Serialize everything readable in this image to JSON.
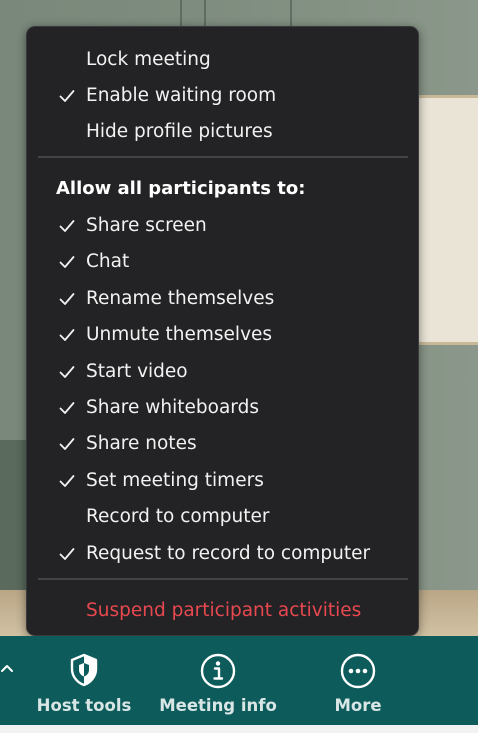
{
  "menu": {
    "top_items": [
      {
        "label": "Lock meeting",
        "checked": false
      },
      {
        "label": "Enable waiting room",
        "checked": true
      },
      {
        "label": "Hide profile pictures",
        "checked": false
      }
    ],
    "section_header": "Allow all participants to:",
    "participant_items": [
      {
        "label": "Share screen",
        "checked": true
      },
      {
        "label": "Chat",
        "checked": true
      },
      {
        "label": "Rename themselves",
        "checked": true
      },
      {
        "label": "Unmute themselves",
        "checked": true
      },
      {
        "label": "Start video",
        "checked": true
      },
      {
        "label": "Share whiteboards",
        "checked": true
      },
      {
        "label": "Share notes",
        "checked": true
      },
      {
        "label": "Set meeting timers",
        "checked": true
      },
      {
        "label": "Record to computer",
        "checked": false
      },
      {
        "label": "Request to record to computer",
        "checked": true
      }
    ],
    "suspend_label": "Suspend participant activities"
  },
  "toolbar": {
    "host_tools_label": "Host tools",
    "meeting_info_label": "Meeting info",
    "more_label": "More"
  },
  "colors": {
    "menu_bg": "#232325",
    "toolbar_bg": "#0e5b5b",
    "danger": "#e8484f"
  },
  "icons": {
    "check": "check-icon",
    "host_tools": "shield-icon",
    "meeting_info": "info-icon",
    "more": "more-icon",
    "chevron": "chevron-up-icon"
  }
}
